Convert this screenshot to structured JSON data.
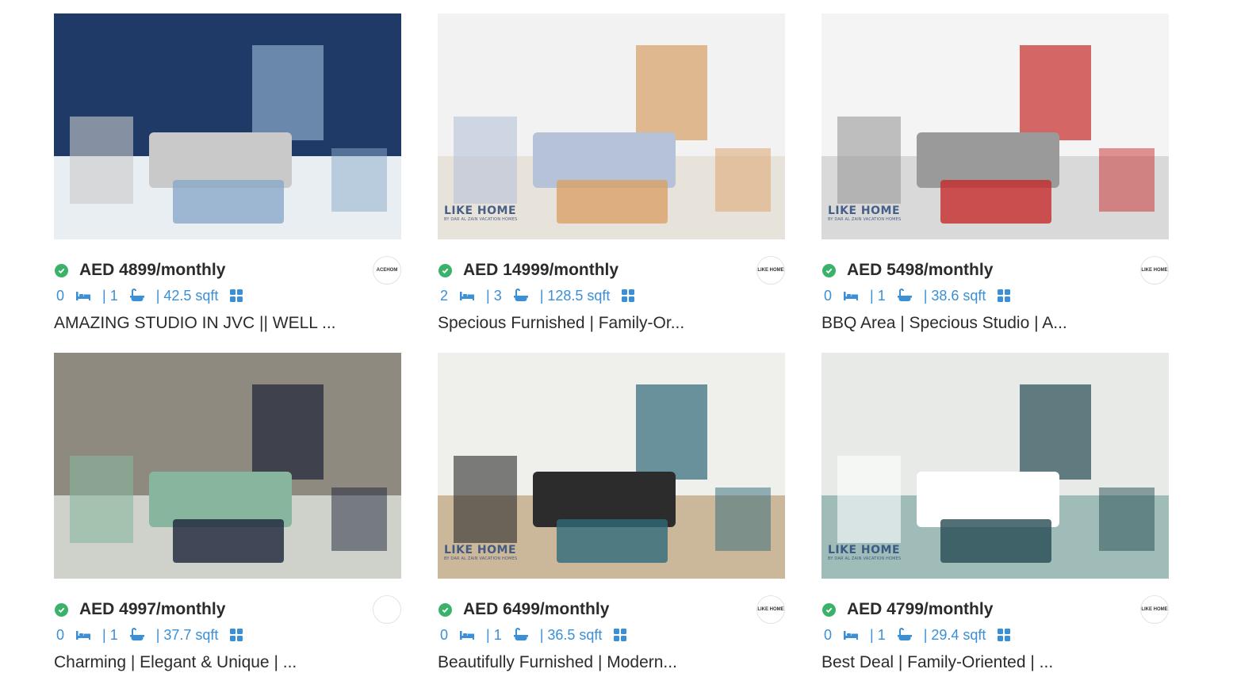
{
  "listings": [
    {
      "price": "AED 4899/monthly",
      "bedrooms": "0",
      "bathrooms": "| 1",
      "area": "| 42.5 sqft",
      "title": "AMAZING STUDIO IN JVC || WELL ...",
      "agency": "ACEHOM",
      "watermark": "",
      "watermark_sub": "",
      "theme": [
        "#1f3a66",
        "#e9eef3",
        "#c9c9c9",
        "#8aa9c9"
      ]
    },
    {
      "price": "AED 14999/monthly",
      "bedrooms": "2",
      "bathrooms": "| 3",
      "area": "| 128.5 sqft",
      "title": "Specious Furnished | Family-Or...",
      "agency": "LIKE HOME",
      "watermark": "LIKE HOME",
      "watermark_sub": "BY DAR AL ZAIN VACATION HOMES",
      "theme": [
        "#f2f2f2",
        "#e8e3da",
        "#b6c2d8",
        "#d9a066"
      ]
    },
    {
      "price": "AED 5498/monthly",
      "bedrooms": "0",
      "bathrooms": "| 1",
      "area": "| 38.6 sqft",
      "title": "BBQ Area | Specious Studio | A...",
      "agency": "LIKE HOME",
      "watermark": "LIKE HOME",
      "watermark_sub": "BY DAR AL ZAIN VACATION HOMES",
      "theme": [
        "#f4f4f4",
        "#d9d9d9",
        "#9a9a9a",
        "#c72a2a"
      ]
    },
    {
      "price": "AED 4997/monthly",
      "bedrooms": "0",
      "bathrooms": "| 1",
      "area": "| 37.7 sqft",
      "title": "Charming | Elegant & Unique | ...",
      "agency": "",
      "watermark": "",
      "watermark_sub": "",
      "theme": [
        "#8f8a80",
        "#cfd2cb",
        "#88b59e",
        "#1c2438"
      ]
    },
    {
      "price": "AED 6499/monthly",
      "bedrooms": "0",
      "bathrooms": "| 1",
      "area": "| 36.5 sqft",
      "title": "Beautifully Furnished | Modern...",
      "agency": "LIKE HOME",
      "watermark": "LIKE HOME",
      "watermark_sub": "BY DAR AL ZAIN VACATION HOMES",
      "theme": [
        "#efefec",
        "#cbb79a",
        "#2c2c2c",
        "#2f6a7a"
      ]
    },
    {
      "price": "AED 4799/monthly",
      "bedrooms": "0",
      "bathrooms": "| 1",
      "area": "| 29.4 sqft",
      "title": "Best Deal | Family-Oriented | ...",
      "agency": "LIKE HOME",
      "watermark": "LIKE HOME",
      "watermark_sub": "BY DAR AL ZAIN VACATION HOMES",
      "theme": [
        "#e7eae7",
        "#9fbcb9",
        "#ffffff",
        "#264b52"
      ]
    }
  ],
  "icons": {
    "verified": "check-circle-icon",
    "bed": "bed-icon",
    "bath": "bathtub-icon",
    "area": "grid-area-icon"
  },
  "colors": {
    "accent": "#3a8fd6",
    "verified": "#3ab26a",
    "text": "#2b2b2b"
  }
}
